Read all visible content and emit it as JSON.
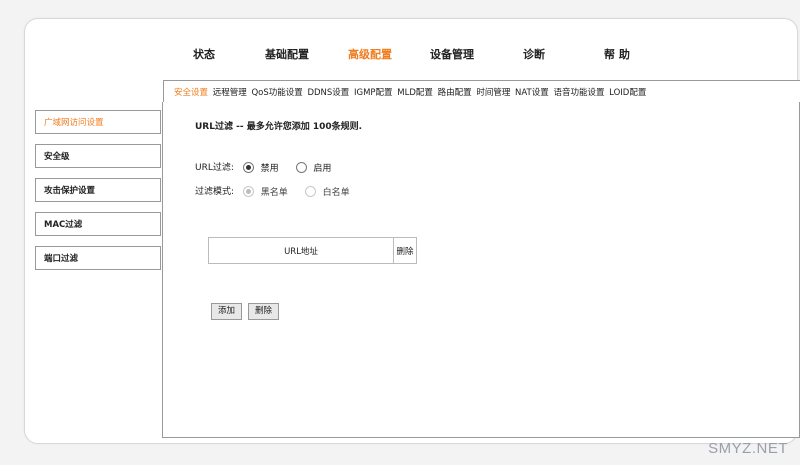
{
  "topnav": {
    "items": [
      "状态",
      "基础配置",
      "高级配置",
      "设备管理",
      "诊断",
      "帮 助"
    ],
    "active_index": 2
  },
  "subnav": {
    "items": [
      "安全设置",
      "远程管理",
      "QoS功能设置",
      "DDNS设置",
      "IGMP配置",
      "MLD配置",
      "路由配置",
      "时间管理",
      "NAT设置",
      "语音功能设置",
      "LOID配置"
    ],
    "active_index": 0
  },
  "sidebar": {
    "items": [
      "广域网访问设置",
      "安全级",
      "攻击保护设置",
      "MAC过滤",
      "端口过滤"
    ],
    "active_index": 0
  },
  "content": {
    "title": "URL过滤 -- 最多允许您添加 100条规则.",
    "url_filter": {
      "label": "URL过滤:",
      "options": [
        "禁用",
        "启用"
      ],
      "selected": "禁用"
    },
    "filter_mode": {
      "label": "过滤模式:",
      "options": [
        "黑名单",
        "白名单"
      ],
      "selected": "黑名单",
      "disabled": true
    },
    "table": {
      "columns": [
        "URL地址",
        "删除"
      ]
    },
    "buttons": {
      "add": "添加",
      "delete": "删除"
    }
  },
  "watermark": "SMYZ.NET",
  "colors": {
    "accent": "#f07d1f",
    "border": "#999999"
  }
}
